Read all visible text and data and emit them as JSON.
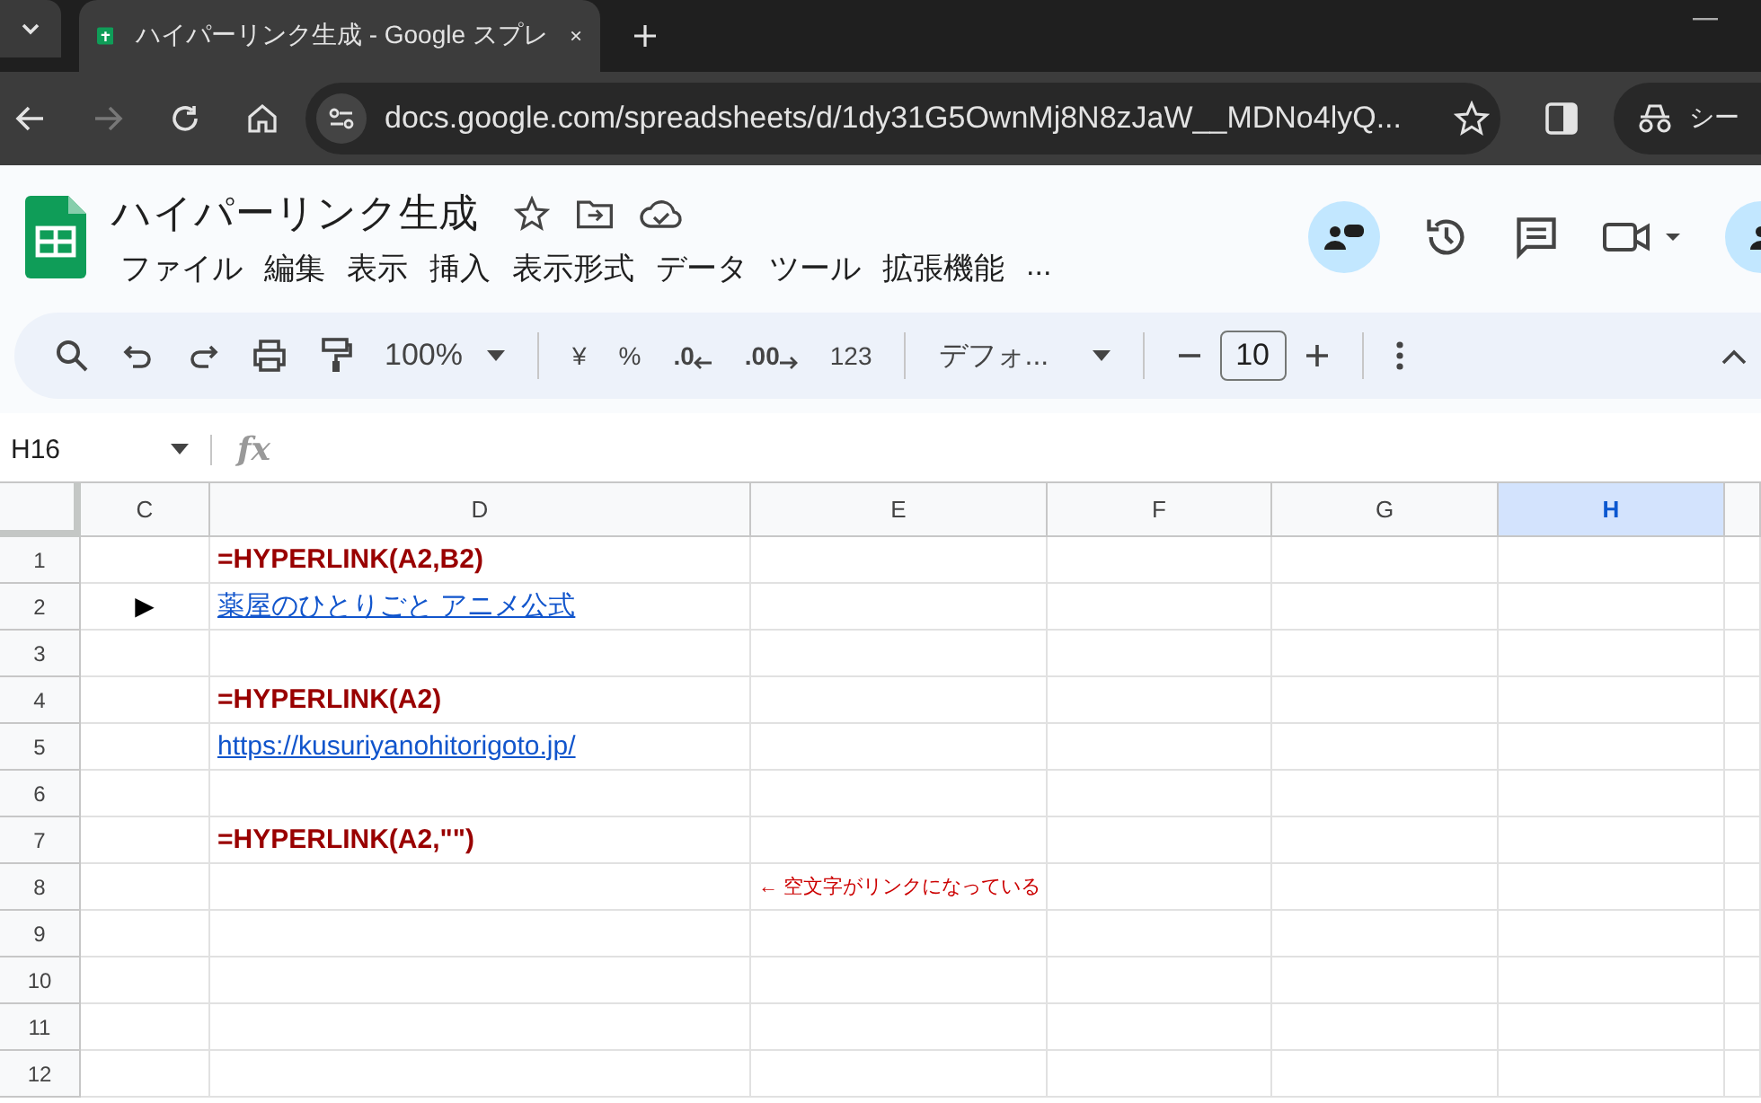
{
  "browser": {
    "tab_title": "ハイパーリンク生成 - Google スプレ",
    "url": "docs.google.com/spreadsheets/d/1dy31G5OwnMj8N8zJaW__MDNo4lyQ...",
    "profile_label": "シー"
  },
  "document": {
    "title": "ハイパーリンク生成",
    "menu": [
      "ファイル",
      "編集",
      "表示",
      "挿入",
      "表示形式",
      "データ",
      "ツール",
      "拡張機能",
      "..."
    ]
  },
  "toolbar": {
    "zoom": "100%",
    "currency": "¥",
    "percent": "%",
    "decimal_decrease": ".0",
    "decimal_increase": ".00",
    "number_format": "123",
    "font": "デフォ...",
    "font_size": "10"
  },
  "formula_bar": {
    "cell_ref": "H16",
    "fx": "fx"
  },
  "sheet": {
    "columns": [
      {
        "label": "C",
        "selected": false
      },
      {
        "label": "D",
        "selected": false
      },
      {
        "label": "E",
        "selected": false
      },
      {
        "label": "F",
        "selected": false
      },
      {
        "label": "G",
        "selected": false
      },
      {
        "label": "H",
        "selected": true
      }
    ],
    "rows": [
      {
        "number": "1",
        "content": {
          "kind": "formula",
          "text": "=HYPERLINK(A2,B2)"
        }
      },
      {
        "number": "2",
        "marker": "▶",
        "content": {
          "kind": "link",
          "text": "薬屋のひとりごと アニメ公式"
        }
      },
      {
        "number": "3"
      },
      {
        "number": "4",
        "content": {
          "kind": "formula",
          "text": "=HYPERLINK(A2)"
        }
      },
      {
        "number": "5",
        "content": {
          "kind": "link",
          "text": "https://kusuriyanohitorigoto.jp/"
        }
      },
      {
        "number": "6"
      },
      {
        "number": "7",
        "content": {
          "kind": "formula",
          "text": "=HYPERLINK(A2,\"\")"
        }
      },
      {
        "number": "8",
        "note": "← 空文字がリンクになっている"
      },
      {
        "number": "9"
      },
      {
        "number": "10"
      },
      {
        "number": "11"
      },
      {
        "number": "12"
      }
    ]
  }
}
